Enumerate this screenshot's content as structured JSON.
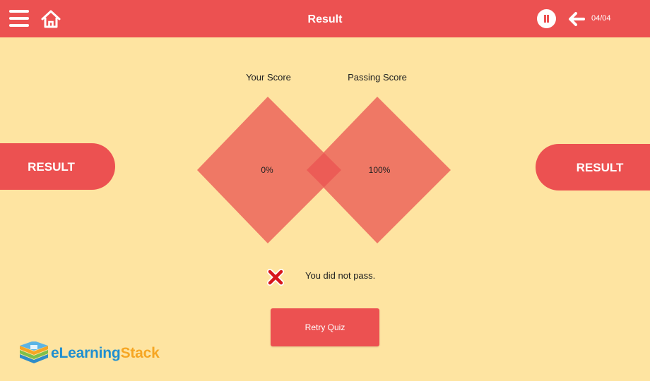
{
  "header": {
    "title": "Result",
    "page_counter": "04/04"
  },
  "left_tab": {
    "label": "RESULT"
  },
  "right_tab": {
    "label": "RESULT"
  },
  "scores": {
    "your_label": "Your Score",
    "your_value": "0%",
    "passing_label": "Passing Score",
    "passing_value": "100%"
  },
  "status": {
    "message": "You did not pass.",
    "icon": "x-mark-icon"
  },
  "retry_button": {
    "label": "Retry Quiz"
  },
  "logo": {
    "text_main": "eLearning",
    "text_accent": "Stack"
  },
  "colors": {
    "accent": "#EC5151",
    "background": "#FEE4A1",
    "diamond": "#EF7865",
    "overlap": "#EC5C56",
    "logo_blue": "#1F8FD0",
    "logo_orange": "#F6A623"
  }
}
